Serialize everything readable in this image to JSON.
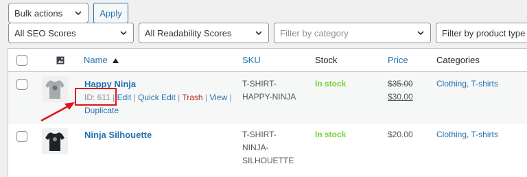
{
  "toolbar": {
    "bulk_actions": "Bulk actions",
    "apply": "Apply",
    "seo_filter": "All SEO Scores",
    "readability_filter": "All Readability Scores",
    "category_placeholder": "Filter by category",
    "product_type_placeholder": "Filter by product type"
  },
  "table": {
    "headers": {
      "name": "Name",
      "sku": "SKU",
      "stock": "Stock",
      "price": "Price",
      "categories": "Categories"
    },
    "rows": [
      {
        "name": "Happy Ninja",
        "sku_line1": "T-SHIRT-",
        "sku_line2": "HAPPY-NINJA",
        "stock": "In stock",
        "regular_price": "$35.00",
        "sale_price": "$30.00",
        "categories": "Clothing, T-shirts",
        "row_actions": {
          "id": "ID: 611",
          "sep": " | ",
          "edit": "Edit",
          "quick_edit": "Quick Edit",
          "trash": "Trash",
          "view": "View",
          "duplicate": "Duplicate"
        }
      },
      {
        "name": "Ninja Silhouette",
        "sku_line1": "T-SHIRT-",
        "sku_line2": "NINJA-",
        "sku_line3": "SILHOUETTE",
        "stock": "In stock",
        "price": "$20.00",
        "categories": "Clothing, T-shirts"
      }
    ]
  },
  "colors": {
    "link": "#2271b1",
    "in_stock": "#7ad03a",
    "trash": "#b32d2e",
    "highlight": "#e0131b"
  }
}
